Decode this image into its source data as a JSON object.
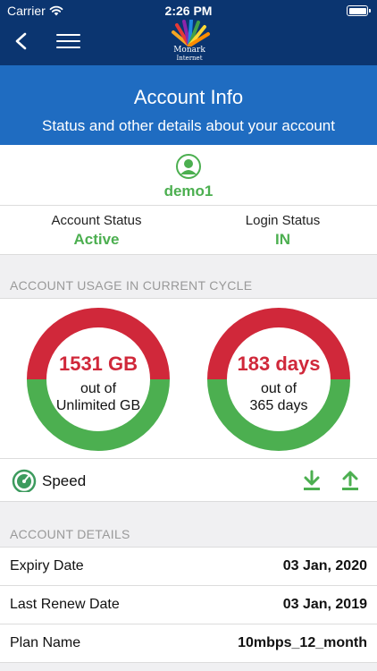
{
  "status_bar": {
    "carrier": "Carrier",
    "time": "2:26 PM"
  },
  "nav": {
    "back_icon": "chevron-left-icon",
    "menu_icon": "hamburger-menu-icon"
  },
  "logo": {
    "name": "Monark",
    "sub": "Internet"
  },
  "banner": {
    "title": "Account Info",
    "subtitle": "Status and other details about your account"
  },
  "user": {
    "username": "demo1",
    "icon": "user-icon"
  },
  "account_status": {
    "label": "Account Status",
    "value": "Active"
  },
  "login_status": {
    "label": "Login Status",
    "value": "IN"
  },
  "usage": {
    "header": "ACCOUNT USAGE IN CURRENT CYCLE",
    "data": {
      "main": "1531 GB",
      "out_of": "out of",
      "total": "Unlimited GB"
    },
    "days": {
      "main": "183 days",
      "out_of": "out of",
      "total": "365 days",
      "used_fraction": 0.5
    }
  },
  "speed": {
    "label": "Speed",
    "icon": "speedometer-icon",
    "download_icon": "download-icon",
    "upload_icon": "upload-icon"
  },
  "details": {
    "header": "ACCOUNT DETAILS",
    "rows": [
      {
        "label": "Expiry Date",
        "value": "03 Jan, 2020"
      },
      {
        "label": "Last Renew Date",
        "value": "03 Jan, 2019"
      },
      {
        "label": "Plan Name",
        "value": "10mbps_12_month"
      }
    ]
  },
  "colors": {
    "nav_bg": "#0b3570",
    "banner_bg": "#1f6cc1",
    "green": "#4caf50",
    "red": "#d0283a"
  }
}
